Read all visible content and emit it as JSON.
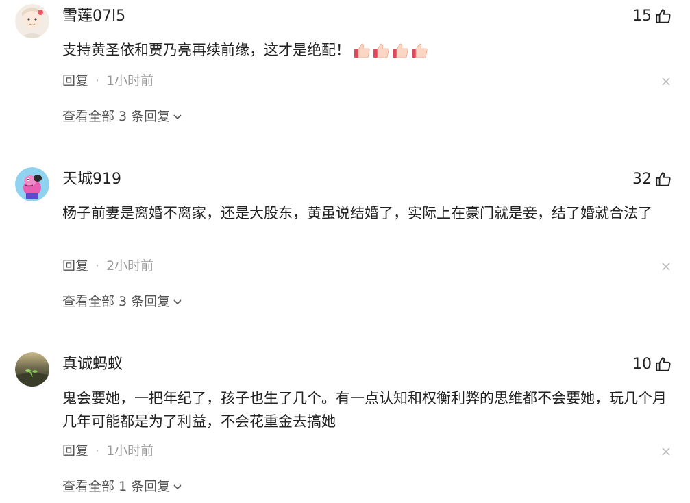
{
  "comments": [
    {
      "username": "雪莲07l5",
      "likes": "15",
      "text": "支持黄圣依和贾乃亮再续前缘，这才是绝配！",
      "emoji_count": 4,
      "reply_label": "回复",
      "separator": "·",
      "time": "1小时前",
      "view_all": "查看全部 3 条回复"
    },
    {
      "username": "天城919",
      "likes": "32",
      "text": "杨子前妻是离婚不离家，还是大股东，黄虽说结婚了，实际上在豪门就是妾，结了婚就合法了",
      "reply_label": "回复",
      "separator": "·",
      "time": "2小时前",
      "view_all": "查看全部 3 条回复"
    },
    {
      "username": "真诚蚂蚁",
      "likes": "10",
      "text": "鬼会要她，一把年纪了，孩子也生了几个。有一点认知和权衡利弊的思维都不会要她，玩几个月几年可能都是为了利益，不会花重金去搞她",
      "reply_label": "回复",
      "separator": "·",
      "time": "1小时前",
      "view_all": "查看全部 1 条回复"
    }
  ],
  "icons": {
    "like": "thumbs-up-icon",
    "close": "close-icon",
    "expand": "chevron-down-icon",
    "emoji": "thumbs-up-emoji"
  },
  "colors": {
    "text": "#222222",
    "meta": "#999999",
    "action": "#555555"
  }
}
